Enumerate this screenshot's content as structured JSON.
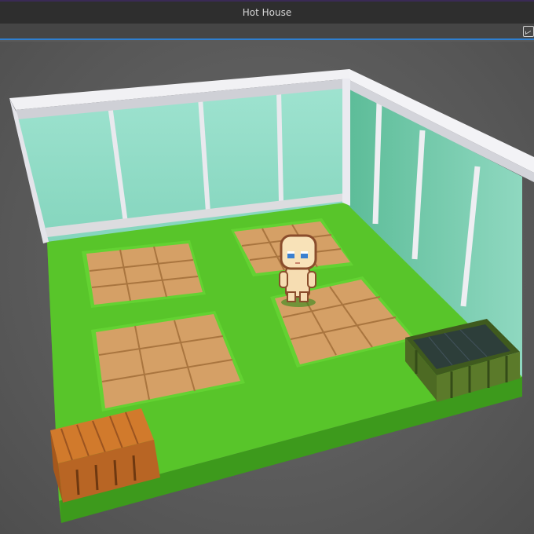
{
  "window": {
    "title": "Hot House"
  },
  "toolbar": {
    "icon": "graph-icon"
  },
  "scene": {
    "floor_color": "#55c428",
    "glass_color": "#8fdcc4",
    "frame_color": "#e9e9ee",
    "soil_color": "#d6a066",
    "soil_line_color": "#a9753f",
    "plots": 4,
    "character": "player-character",
    "objects": [
      "wooden-crate",
      "water-trough"
    ]
  }
}
